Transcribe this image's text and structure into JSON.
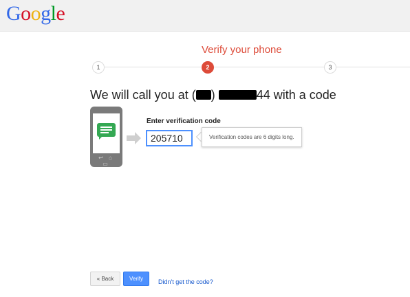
{
  "header": {
    "logo_letters": [
      {
        "ch": "G",
        "color": "#3369e8"
      },
      {
        "ch": "o",
        "color": "#d50f25"
      },
      {
        "ch": "o",
        "color": "#eeb211"
      },
      {
        "ch": "g",
        "color": "#3369e8"
      },
      {
        "ch": "l",
        "color": "#009925"
      },
      {
        "ch": "e",
        "color": "#d50f25"
      }
    ]
  },
  "progress": {
    "title": "Verify your phone",
    "steps": [
      "1",
      "2",
      "3"
    ],
    "active_step": 2
  },
  "main": {
    "headline_prefix": "We will call you at (",
    "headline_mid": ") ",
    "headline_suffix": "44 with a code",
    "field_label": "Enter verification code",
    "code_value": "205710",
    "tooltip": "Verification codes are 6 digits long.",
    "phone_keys": "↩ ⌂ ▭"
  },
  "footer": {
    "back_label": "« Back",
    "verify_label": "Verify",
    "help_link": "Didn't get the code?"
  },
  "colors": {
    "accent": "#dd4b39",
    "button_blue": "#4d90fe",
    "message_green": "#34a853"
  }
}
